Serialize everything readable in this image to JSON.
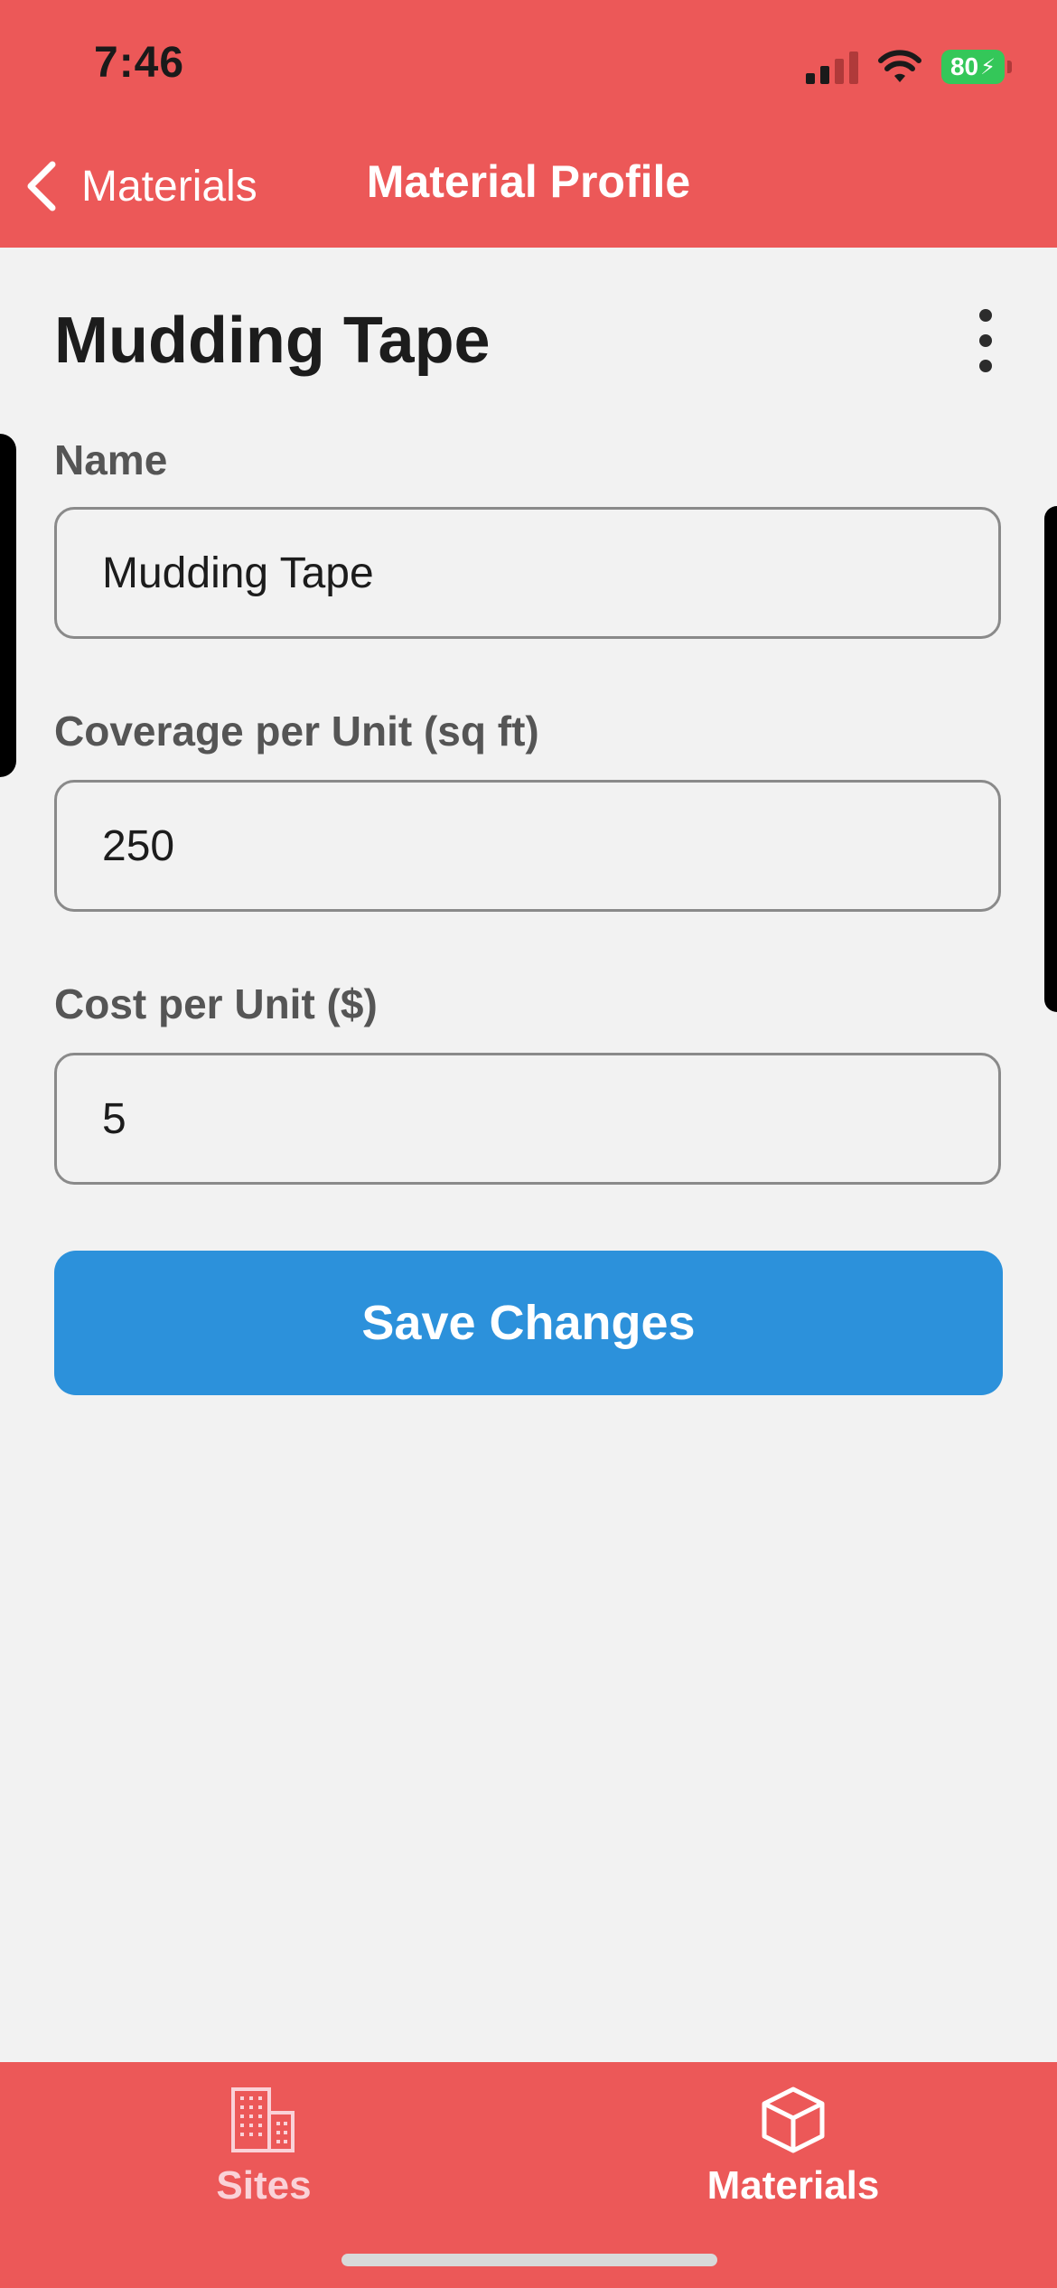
{
  "status_bar": {
    "time": "7:46",
    "battery": "80",
    "icons": [
      "cellular-signal-icon",
      "wifi-icon",
      "battery-charging-icon"
    ]
  },
  "nav": {
    "back_label": "Materials",
    "title": "Material Profile"
  },
  "page": {
    "title": "Mudding Tape",
    "menu_icon": "more-vertical-icon"
  },
  "form": {
    "name": {
      "label": "Name",
      "value": "Mudding Tape"
    },
    "coverage": {
      "label": "Coverage per Unit (sq ft)",
      "value": "250"
    },
    "cost": {
      "label": "Cost per Unit ($)",
      "value": "5"
    },
    "save_label": "Save Changes"
  },
  "tabbar": {
    "items": [
      {
        "label": "Sites",
        "icon": "building-icon",
        "active": false
      },
      {
        "label": "Materials",
        "icon": "cube-icon",
        "active": true
      }
    ]
  },
  "colors": {
    "header": "#EC5858",
    "accent_button": "#2C91DB",
    "background": "#F2F2F2",
    "battery": "#34C759"
  }
}
